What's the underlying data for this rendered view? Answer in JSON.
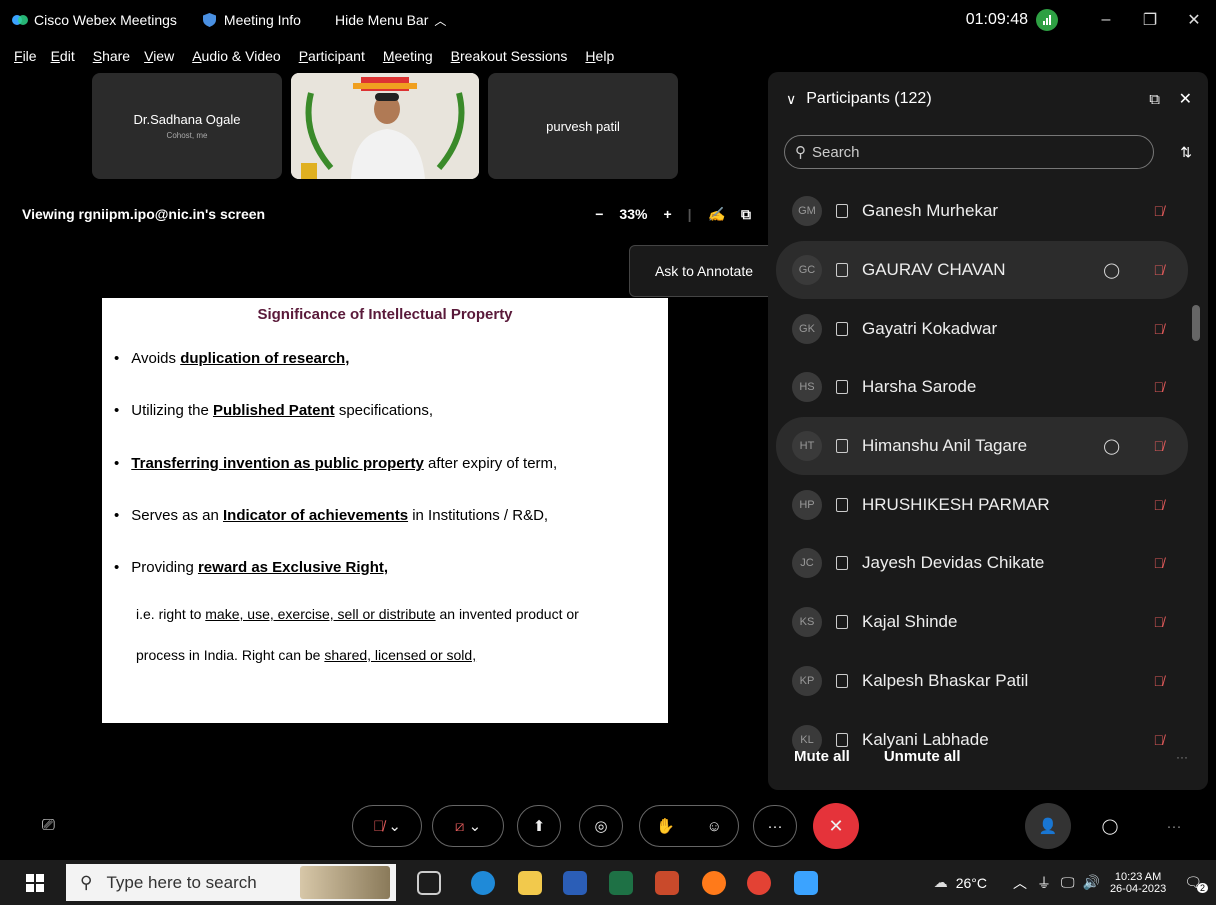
{
  "titlebar": {
    "app_name": "Cisco Webex Meetings",
    "meeting_info": "Meeting Info",
    "hide_menu": "Hide Menu Bar",
    "clock": "01:09:48"
  },
  "menu": [
    "File",
    "Edit",
    "Share",
    "View",
    "Audio & Video",
    "Participant",
    "Meeting",
    "Breakout Sessions",
    "Help"
  ],
  "tiles": [
    {
      "name": "Dr.Sadhana Ogale",
      "sub": "Cohost, me"
    },
    {
      "name": "purvesh patil",
      "sub": ""
    }
  ],
  "viewing": {
    "label": "Viewing rgniipm.ipo@nic.in's screen",
    "zoom": "33%",
    "tooltip": "Ask to Annotate"
  },
  "slide": {
    "title": "Significance of Intellectual Property",
    "b1_pre": "Avoids ",
    "b1_bold": "duplication of research,",
    "b2_pre": "Utilizing the ",
    "b2_bold": "Published Patent",
    "b2_post": " specifications,",
    "b3_bold": "Transferring invention as public property",
    "b3_post": " after expiry of term,",
    "b4_pre": "Serves as an ",
    "b4_bold": "Indicator of achievements",
    "b4_post": " in Institutions / R&D,",
    "b5_pre": "Providing ",
    "b5_bold": "reward as Exclusive Right,",
    "p1_pre": "i.e. right to ",
    "p1_u": "make, use, exercise, sell or  distribute",
    "p1_post": " an invented product or",
    "p2_pre": "process in India. Right can be ",
    "p2_u": "shared, licensed or sold,"
  },
  "participants": {
    "header": "Participants (122)",
    "search_placeholder": "Search",
    "mute_all": "Mute all",
    "unmute_all": "Unmute all",
    "list": [
      {
        "initials": "GM",
        "name": "Ganesh Murhekar",
        "chat": false,
        "highlight": false
      },
      {
        "initials": "GC",
        "name": "GAURAV CHAVAN",
        "chat": true,
        "highlight": true
      },
      {
        "initials": "GK",
        "name": "Gayatri Kokadwar",
        "chat": false,
        "highlight": false
      },
      {
        "initials": "HS",
        "name": "Harsha Sarode",
        "chat": false,
        "highlight": false
      },
      {
        "initials": "HT",
        "name": "Himanshu Anil Tagare",
        "chat": true,
        "highlight": true
      },
      {
        "initials": "HP",
        "name": "HRUSHIKESH PARMAR",
        "chat": false,
        "highlight": false
      },
      {
        "initials": "JC",
        "name": "Jayesh Devidas Chikate",
        "chat": false,
        "highlight": false
      },
      {
        "initials": "KS",
        "name": "Kajal Shinde",
        "chat": false,
        "highlight": false
      },
      {
        "initials": "KP",
        "name": "Kalpesh Bhaskar Patil",
        "chat": false,
        "highlight": false
      },
      {
        "initials": "KL",
        "name": "Kalyani Labhade",
        "chat": false,
        "highlight": false
      }
    ]
  },
  "taskbar": {
    "search_placeholder": "Type here to search",
    "weather": "26°C",
    "time": "10:23 AM",
    "date": "26-04-2023",
    "notif_count": "2"
  }
}
